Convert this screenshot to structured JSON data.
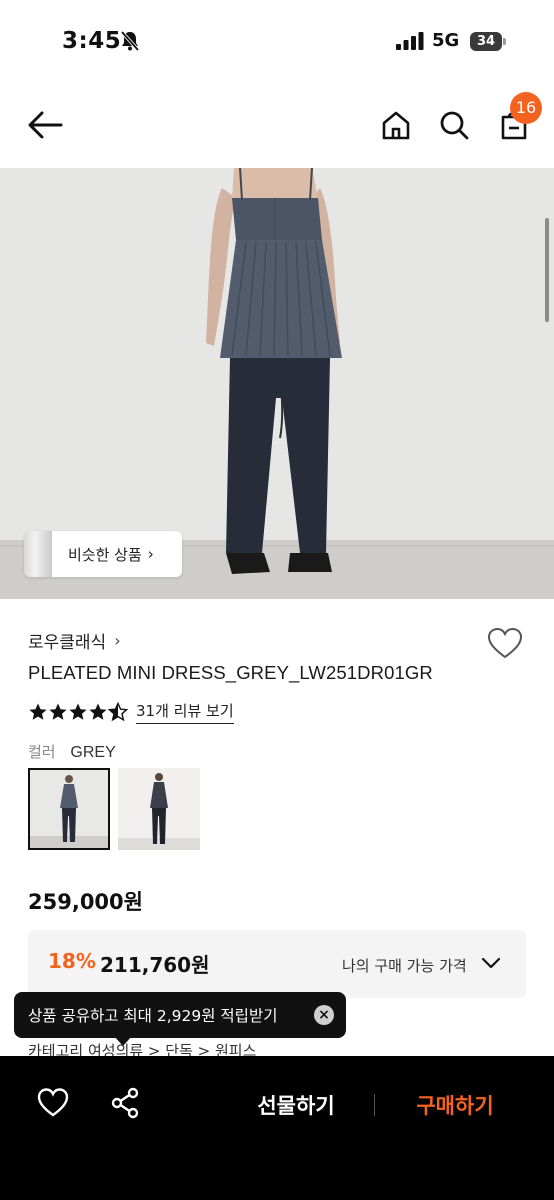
{
  "status_bar": {
    "time": "3:45",
    "network": "5G",
    "battery": "34"
  },
  "header": {
    "cart_count": "16",
    "icons": [
      "back-arrow-icon",
      "home-icon",
      "search-icon",
      "shopping-bag-icon"
    ]
  },
  "hero": {
    "similar_label": "비슷한 상품",
    "similar_chevron": "›"
  },
  "product": {
    "brand": "로우클래식",
    "brand_chevron": "›",
    "name": "PLEATED MINI DRESS_GREY_LW251DR01GR",
    "rating": 4.5,
    "review_link": "31개 리뷰 보기",
    "color_label": "컬러",
    "color_value": "GREY",
    "price": "259,000원",
    "discount": "18%",
    "sale_price": "211,760원",
    "my_price_label": "나의 구매 가능 가격"
  },
  "category_peek": "카테고리   여성의류 > 단독 > 원피스",
  "toast": {
    "text": "상품 공유하고 최대 2,929원 적립받기",
    "close": "×"
  },
  "bottom_bar": {
    "gift_label": "선물하기",
    "buy_label": "구매하기"
  },
  "colors": {
    "accent": "#f3631f",
    "dark": "#000000"
  }
}
